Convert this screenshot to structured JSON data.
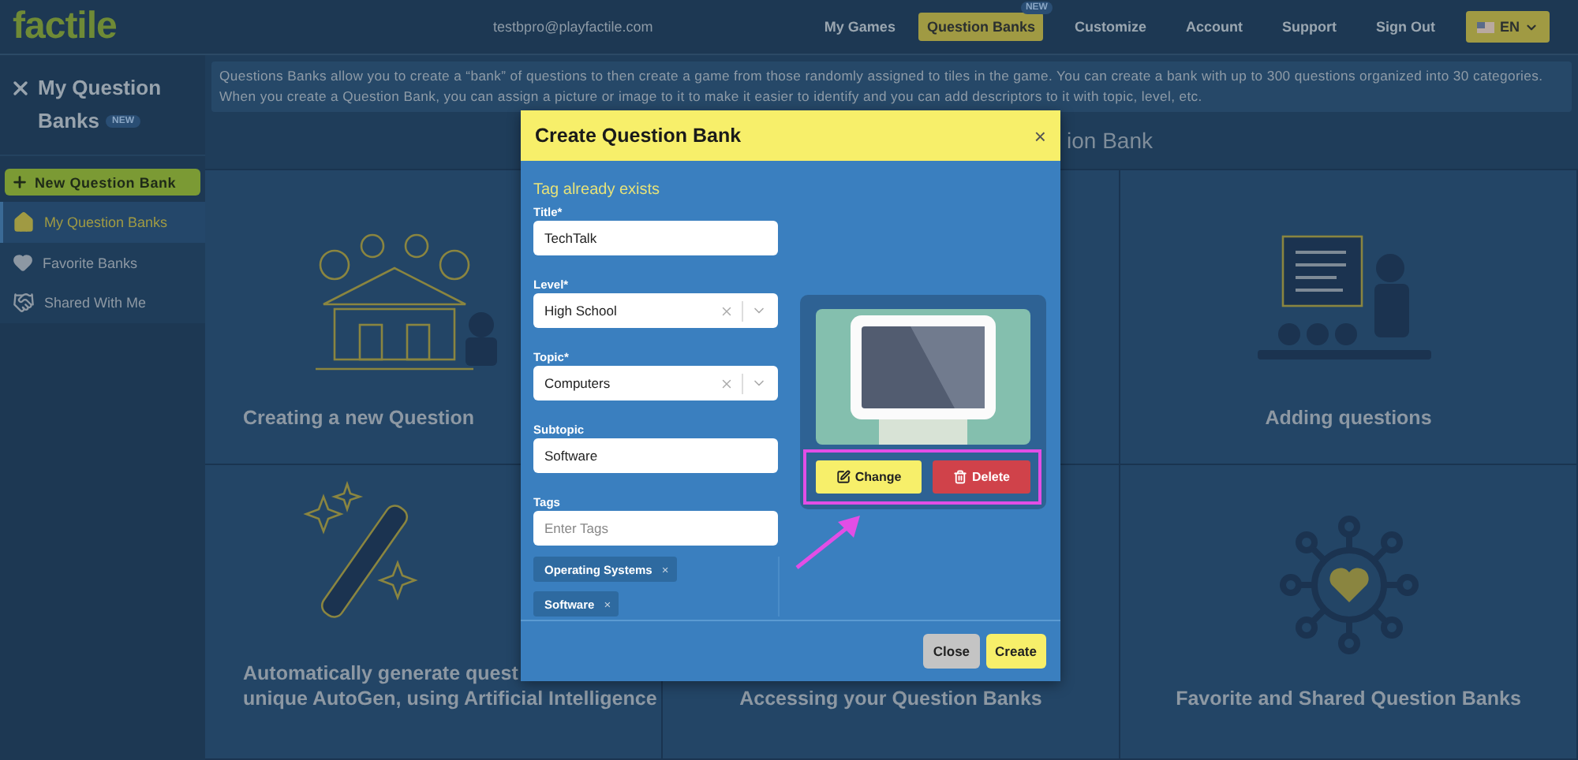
{
  "nav": {
    "logo": "factile",
    "email": "testbpro@playfactile.com",
    "items": [
      {
        "label": "My Games",
        "selected": false
      },
      {
        "label": "Question Banks",
        "selected": true,
        "badge": "NEW"
      },
      {
        "label": "Customize",
        "selected": false
      },
      {
        "label": "Account",
        "selected": false
      },
      {
        "label": "Support",
        "selected": false
      },
      {
        "label": "Sign Out",
        "selected": false
      }
    ],
    "language": "EN"
  },
  "sidebar": {
    "title": "My Question Banks",
    "badge": "NEW",
    "new_button": "New Question Bank",
    "items": [
      {
        "label": "My Question Banks",
        "selected": true
      },
      {
        "label": "Favorite Banks",
        "selected": false
      },
      {
        "label": "Shared With Me",
        "selected": false
      }
    ]
  },
  "main": {
    "intro": "Questions Banks allow you to create a “bank” of questions to then create a game from those randomly assigned to tiles in the game. You can create a bank with up to 300 questions organized into 30 categories. When you create a Question Bank, you can assign a picture or image to it to make it easier to identify and you can add descriptors to it with topic, level, etc.",
    "heading": "ion Bank",
    "cards": [
      {
        "lines": [
          "Creating a new Question"
        ]
      },
      {
        "lines": [
          "Adding questions"
        ]
      },
      {
        "lines": [
          "Automatically generate quest",
          "unique AutoGen, using Artificial Intelligence"
        ]
      },
      {
        "lines": [
          "Accessing your Question Banks"
        ]
      },
      {
        "lines": [
          "Favorite and Shared Question Banks"
        ]
      }
    ]
  },
  "modal": {
    "title": "Create Question Bank",
    "close": "×",
    "warning": "Tag already exists",
    "fields": [
      {
        "kind": "text",
        "label": "Title*",
        "value": "TechTalk"
      },
      {
        "kind": "select",
        "label": "Level*",
        "value": "High School"
      },
      {
        "kind": "select",
        "label": "Topic*",
        "value": "Computers"
      },
      {
        "kind": "text",
        "label": "Subtopic",
        "value": "Software"
      },
      {
        "kind": "tags",
        "label": "Tags",
        "placeholder": "Enter Tags"
      }
    ],
    "tags": [
      {
        "label": "Operating Systems",
        "remove": "×"
      },
      {
        "label": "Software",
        "remove": "×"
      }
    ],
    "image_buttons": [
      {
        "label": "Change",
        "kind": "change"
      },
      {
        "label": "Delete",
        "kind": "delete"
      }
    ],
    "footer_buttons": [
      {
        "label": "Close",
        "kind": "secondary"
      },
      {
        "label": "Create",
        "kind": "primary"
      }
    ]
  }
}
